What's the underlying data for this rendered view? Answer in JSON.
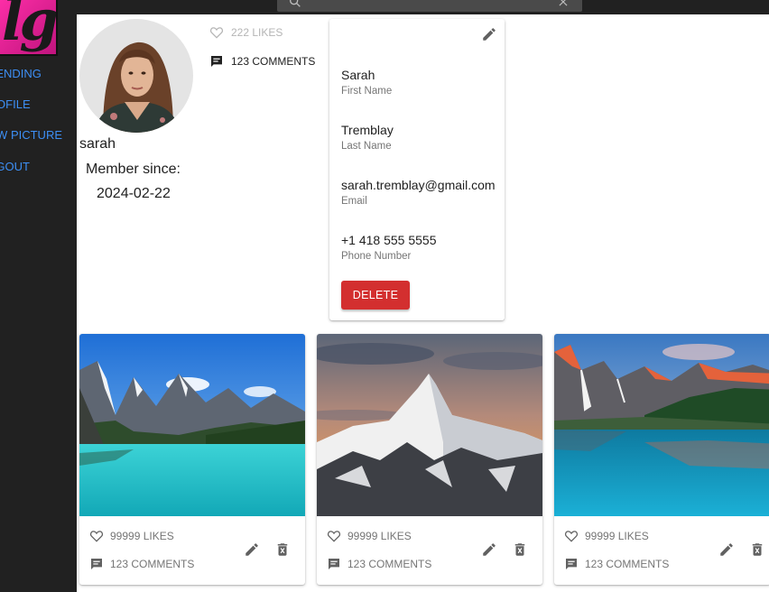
{
  "sidebar": {
    "logo_text": "lg",
    "items": [
      {
        "label": "Trending",
        "icon": "none"
      },
      {
        "label": "Profile",
        "icon": "none"
      },
      {
        "label": "New Picture",
        "icon": "none"
      },
      {
        "label": "Logout",
        "icon": "none"
      }
    ]
  },
  "topbar": {
    "search_icon": "search-icon",
    "clear_icon": "close-icon"
  },
  "profile": {
    "username": "sarah",
    "member_since_label": "Member since:",
    "member_since_date": "2024-02-22",
    "likes_text": "222 LIKES",
    "comments_text": "123 COMMENTS"
  },
  "info": {
    "first_name": "Sarah",
    "first_name_label": "First Name",
    "last_name": "Tremblay",
    "last_name_label": "Last Name",
    "email": "sarah.tremblay@gmail.com",
    "email_label": "Email",
    "phone": "+1 418 555 5555",
    "phone_label": "Phone Number",
    "delete_label": "Delete"
  },
  "pictures": [
    {
      "likes_text": "99999 LIKES",
      "comments_text": "123 COMMENTS"
    },
    {
      "likes_text": "99999 LIKES",
      "comments_text": "123 COMMENTS"
    },
    {
      "likes_text": "99999 LIKES",
      "comments_text": "123 COMMENTS"
    }
  ],
  "colors": {
    "sidebar_bg": "#212121",
    "nav_link": "#3d8ff5",
    "delete_button": "#d32f2f",
    "logo_pink": "#e91e8c"
  }
}
